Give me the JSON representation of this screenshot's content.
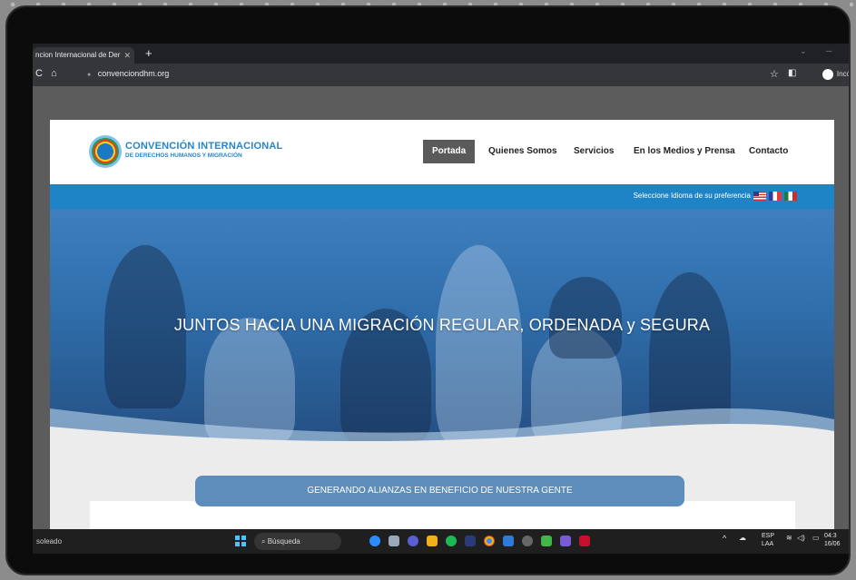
{
  "browser": {
    "tab_title": "ncion Internacional de Der",
    "tab_close": "✕",
    "new_tab": "+",
    "url": "convenciondhm.org",
    "profile_label": "Incó",
    "minimize": "─",
    "chevron": "⌄"
  },
  "site": {
    "logo_line1": "CONVENCIÓN INTERNACIONAL",
    "logo_line2": "DE DERECHOS HUMANOS Y MIGRACIÓN",
    "nav": [
      "Portada",
      "Quienes Somos",
      "Servicios",
      "En los Medios y Prensa",
      "Contacto"
    ],
    "language_prompt": "Seleccione Idioma de su preferencia",
    "hero_title": "JUNTOS HACIA UNA MIGRACIÓN REGULAR, ORDENADA y SEGURA",
    "section_button": "GENERANDO ALIANZAS EN BENEFICIO DE NUESTRA GENTE"
  },
  "taskbar": {
    "weather": "soleado",
    "search_placeholder": "Búsqueda",
    "language": "ESP",
    "region": "LAA",
    "time": "04:3",
    "date": "16/06"
  },
  "colors": {
    "brand_blue": "#2784c9",
    "language_bar": "#1f84c6",
    "section_button": "#5d8dbb"
  }
}
